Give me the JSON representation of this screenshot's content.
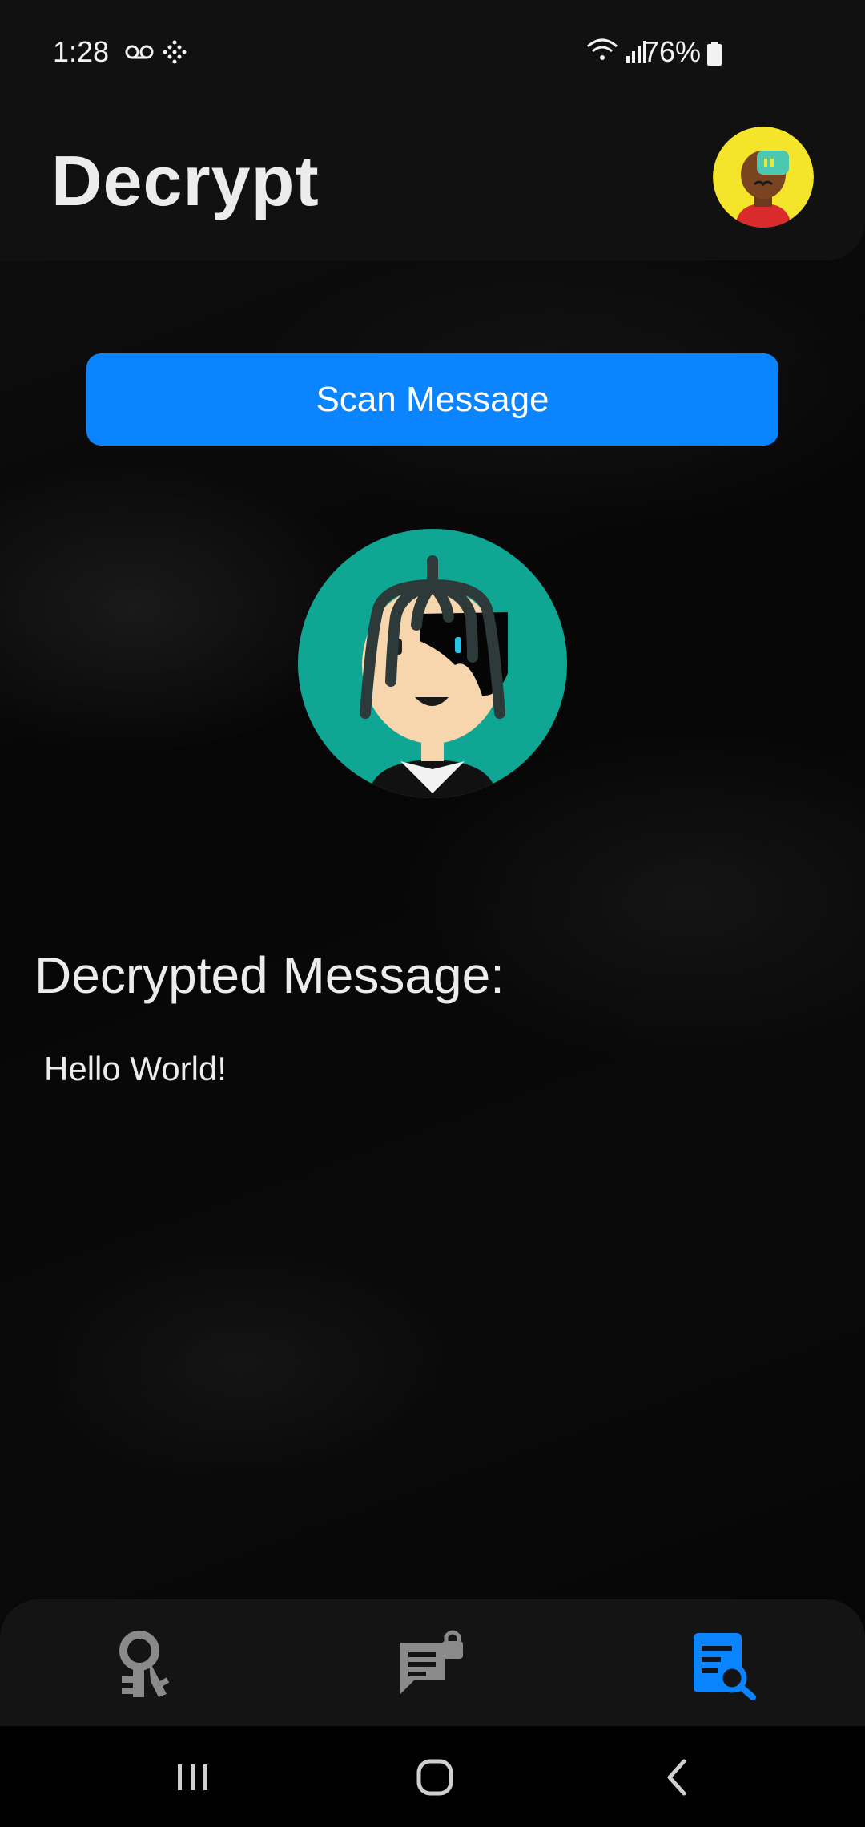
{
  "status_bar": {
    "time": "1:28",
    "battery_percent": "76%",
    "icons": [
      "voicemail-icon",
      "grid-dots-icon",
      "wifi-icon",
      "signal-icon",
      "battery-icon"
    ]
  },
  "app_bar": {
    "title": "Decrypt",
    "avatar_icon": "profile-avatar-icon"
  },
  "main": {
    "scan_button_label": "Scan Message",
    "contact_avatar_icon": "contact-avatar-icon",
    "decrypted_heading": "Decrypted Message:",
    "decrypted_text": "Hello World!"
  },
  "bottom_nav": {
    "items": [
      {
        "icon": "keys-icon",
        "active": false
      },
      {
        "icon": "locked-message-icon",
        "active": false
      },
      {
        "icon": "decrypt-search-icon",
        "active": true
      }
    ],
    "active_color": "#0a84ff",
    "inactive_color": "#8a8a8a"
  },
  "system_nav": {
    "buttons": [
      "recents-icon",
      "home-icon",
      "back-icon"
    ]
  },
  "colors": {
    "accent": "#0a84ff",
    "bar_background": "#111111",
    "text": "#ececec"
  }
}
